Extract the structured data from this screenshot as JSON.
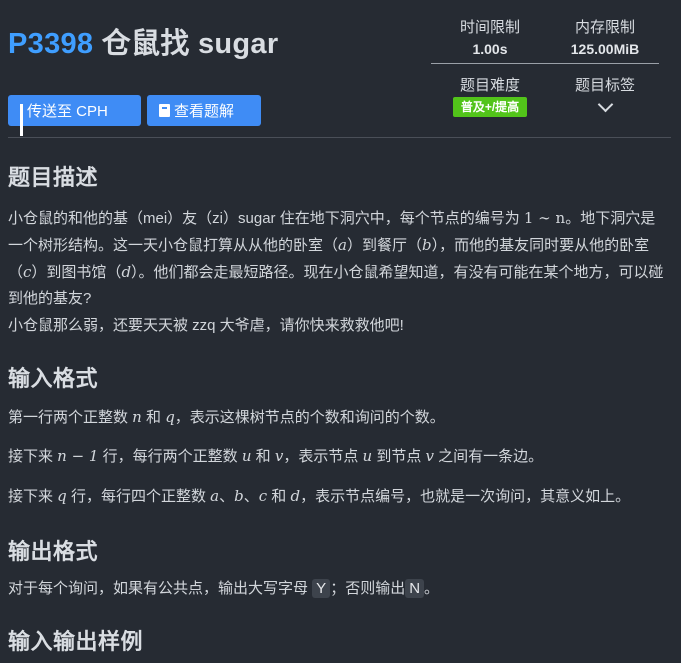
{
  "problem": {
    "id": "P3398",
    "name": "仓鼠找 sugar"
  },
  "stats": {
    "time_limit_label": "时间限制",
    "time_limit_value": "1.00s",
    "memory_limit_label": "内存限制",
    "memory_limit_value": "125.00MiB",
    "difficulty_label": "题目难度",
    "difficulty_value": "普及+/提高",
    "tags_label": "题目标签"
  },
  "colors": {
    "accent": "#3f9eff",
    "button": "#3f8cf5",
    "difficulty": "#52c41a",
    "background": "#262b33"
  },
  "buttons": {
    "send_cph": "传送至 CPH",
    "view_solution": "查看题解"
  },
  "icons": {
    "send_cph": "bar-chart-icon",
    "view_solution": "book-icon",
    "tags_expand": "chevron-down-icon"
  },
  "sections": {
    "description_title": "题目描述",
    "input_title": "输入格式",
    "output_title": "输出格式",
    "samples_title": "输入输出样例"
  },
  "description": {
    "p1_a": "小仓鼠的和他的基（mei）友（zi）sugar 住在地下洞穴中，每个节点的编号为 ",
    "p1_b": "。地下洞穴是一个树形结构。这一天小仓鼠打算从从他的卧室（",
    "p1_c": "）到餐厅（",
    "p1_d": "），而他的基友同时要从他的卧室（",
    "p1_e": "）到图书馆（",
    "p1_f": "）。他们都会走最短路径。现在小仓鼠希望知道，有没有可能在某个地方，可以碰到他的基友?",
    "p2": "小仓鼠那么弱，还要天天被 zzq 大爷虐，请你快来救救他吧!"
  },
  "input_format": {
    "l1_a": "第一行两个正整数 ",
    "l1_b": " 和 ",
    "l1_c": "，表示这棵树节点的个数和询问的个数。",
    "l2_a": "接下来 ",
    "l2_b": " 行，每行两个正整数 ",
    "l2_c": " 和 ",
    "l2_d": "，表示节点 ",
    "l2_e": " 到节点 ",
    "l2_f": " 之间有一条边。",
    "l3_a": "接下来 ",
    "l3_b": " 行，每行四个正整数 ",
    "l3_c": "、",
    "l3_d": "、",
    "l3_e": " 和 ",
    "l3_f": "，表示节点编号，也就是一次询问，其意义如上。"
  },
  "output_format": {
    "a": "对于每个询问，如果有公共点，输出大写字母 ",
    "yes": "Y",
    "b": "；否则输出",
    "no": "N",
    "c": "。"
  },
  "math": {
    "range": "1 ∼ n",
    "a": "a",
    "b": "b",
    "c": "c",
    "d": "d",
    "n": "n",
    "q": "q",
    "n_minus_1": "n − 1",
    "u": "u",
    "v": "v"
  }
}
